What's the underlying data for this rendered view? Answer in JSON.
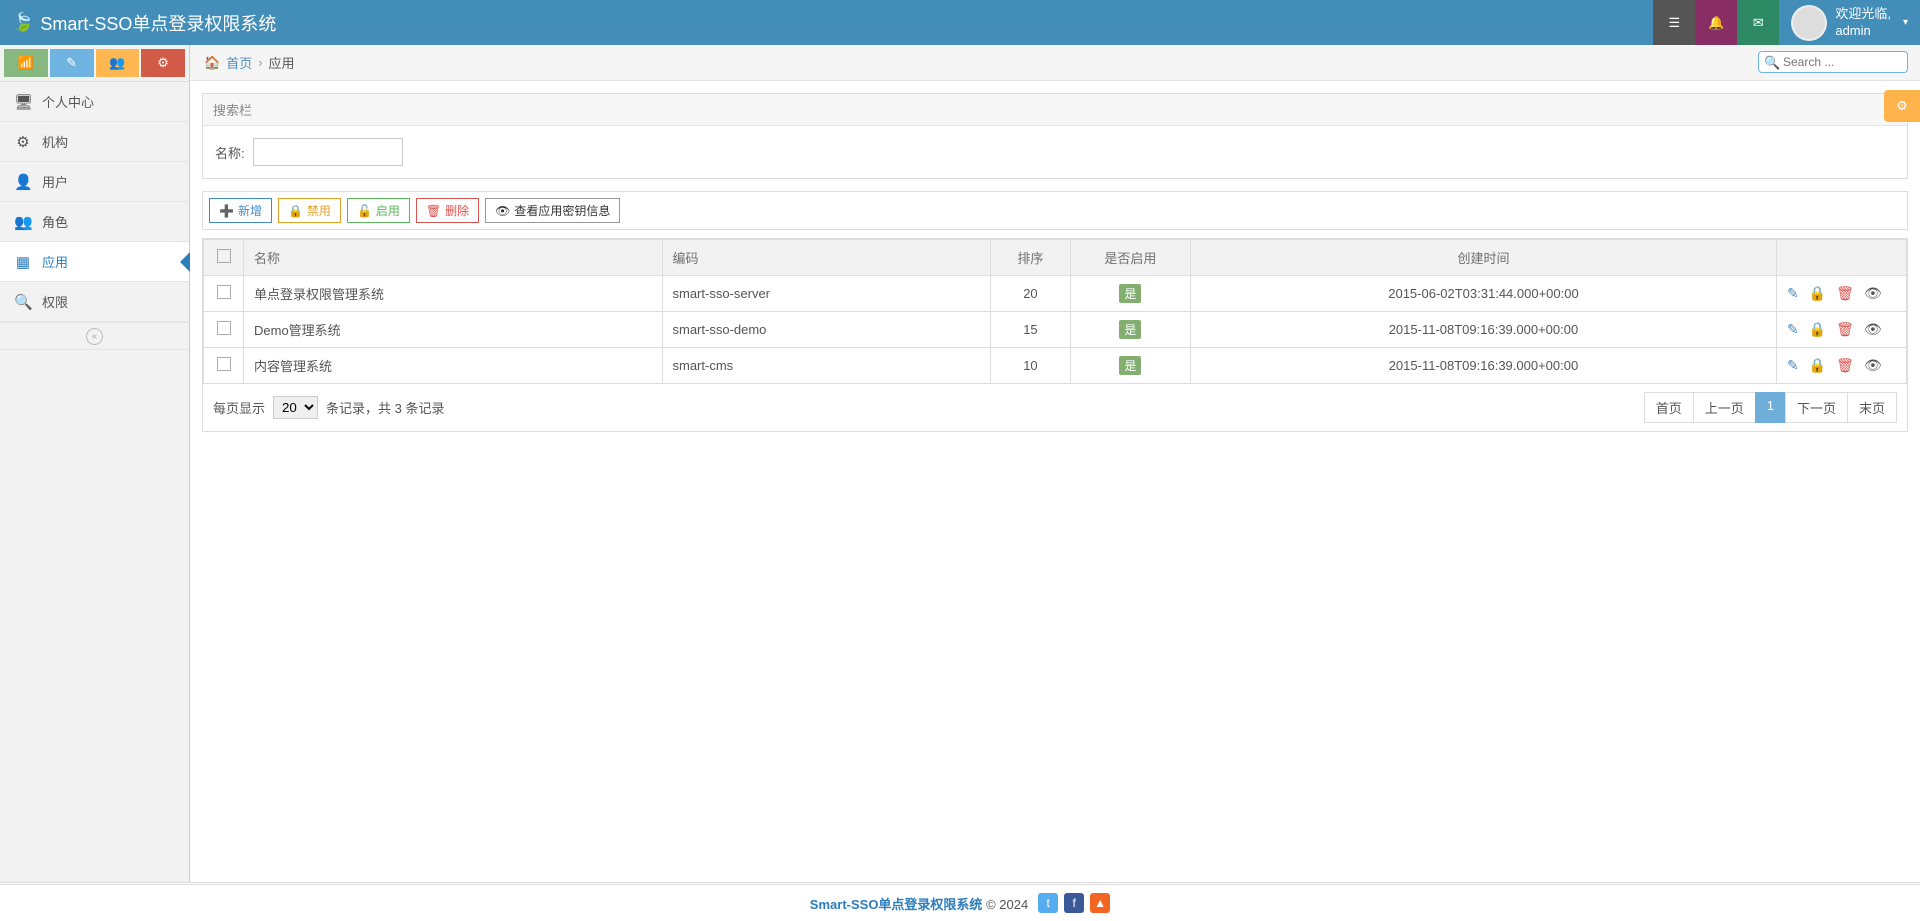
{
  "app": {
    "title": "Smart-SSO单点登录权限系统"
  },
  "user": {
    "greeting": "欢迎光临,",
    "name": "admin"
  },
  "sidebar": {
    "items": [
      {
        "label": "个人中心",
        "icon": "🖥"
      },
      {
        "label": "机构",
        "icon": "⚙"
      },
      {
        "label": "用户",
        "icon": "👤"
      },
      {
        "label": "角色",
        "icon": "👥"
      },
      {
        "label": "应用",
        "icon": "▦"
      },
      {
        "label": "权限",
        "icon": "🔍"
      }
    ]
  },
  "breadcrumbs": {
    "home": "首页",
    "current": "应用"
  },
  "search": {
    "placeholder": "Search ..."
  },
  "panel": {
    "title": "搜索栏",
    "name_label": "名称:"
  },
  "toolbar": {
    "add": "新增",
    "disable": "禁用",
    "enable": "启用",
    "delete": "删除",
    "viewkey": "查看应用密钥信息"
  },
  "table": {
    "headers": {
      "name": "名称",
      "code": "编码",
      "sort": "排序",
      "enabled": "是否启用",
      "created": "创建时间"
    },
    "enabled_yes": "是",
    "rows": [
      {
        "name": "单点登录权限管理系统",
        "code": "smart-sso-server",
        "sort": "20",
        "created": "2015-06-02T03:31:44.000+00:00"
      },
      {
        "name": "Demo管理系统",
        "code": "smart-sso-demo",
        "sort": "15",
        "created": "2015-11-08T09:16:39.000+00:00"
      },
      {
        "name": "内容管理系统",
        "code": "smart-cms",
        "sort": "10",
        "created": "2015-11-08T09:16:39.000+00:00"
      }
    ]
  },
  "pager": {
    "per_page_label": "每页显示",
    "per_page_value": "20",
    "records_text": "条记录，共 3 条记录",
    "first": "首页",
    "prev": "上一页",
    "page": "1",
    "next": "下一页",
    "last": "末页"
  },
  "footer": {
    "brand": "Smart-SSO单点登录权限系统",
    "copyright": "© 2024"
  }
}
